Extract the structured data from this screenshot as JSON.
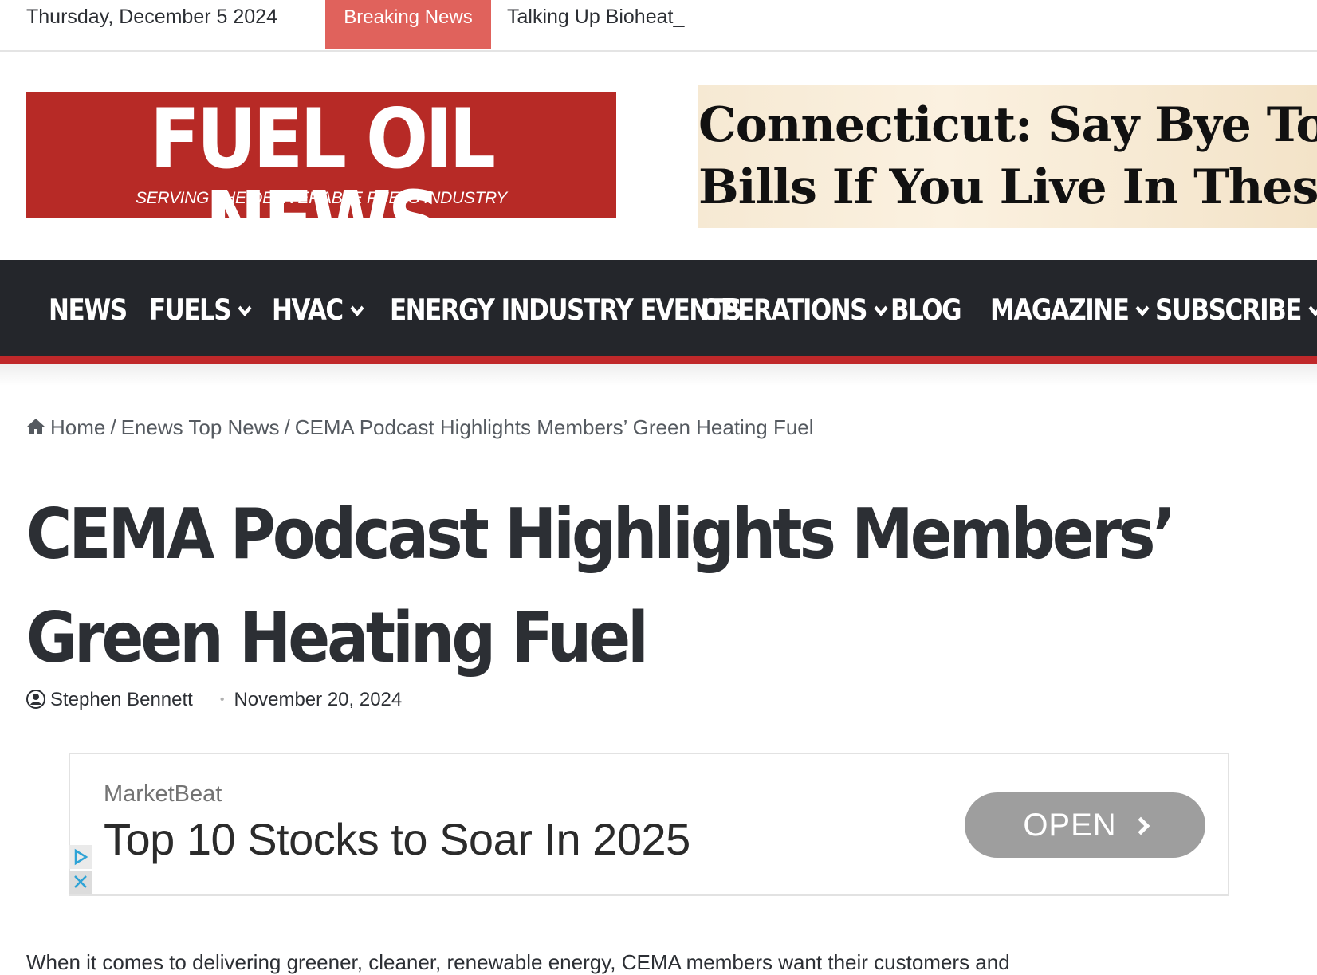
{
  "topbar": {
    "date": "Thursday, December 5 2024",
    "breaking_label": "Breaking News",
    "ticker_text": "Talking Up Bioheat_"
  },
  "header": {
    "logo_title": "FUEL OIL NEWS",
    "logo_subtitle": "SERVING THE DELIVERABLE FUELS INDUSTRY",
    "ad_line1": "Connecticut: Say Bye To",
    "ad_line2": "Bills If You Live In Thes"
  },
  "nav": {
    "items": [
      {
        "label": "NEWS",
        "dropdown": false
      },
      {
        "label": "FUELS",
        "dropdown": true
      },
      {
        "label": "HVAC",
        "dropdown": true
      },
      {
        "label": "ENERGY INDUSTRY EVENTS",
        "dropdown": false
      },
      {
        "label": "OPERATIONS",
        "dropdown": true
      },
      {
        "label": "BLOG",
        "dropdown": false
      },
      {
        "label": "MAGAZINE",
        "dropdown": true
      },
      {
        "label": "SUBSCRIBE",
        "dropdown": true
      }
    ]
  },
  "breadcrumb": {
    "home": "Home",
    "sep": "/",
    "section": "Enews Top News",
    "current": "CEMA Podcast Highlights Members’ Green Heating Fuel"
  },
  "article": {
    "title": "CEMA Podcast Highlights Members’ Green Heating Fuel",
    "author": "Stephen Bennett",
    "meta_dot": "•",
    "date": "November 20, 2024",
    "body_first_line": "When it comes to delivering greener, cleaner, renewable energy, CEMA members want their customers and"
  },
  "ad": {
    "source": "MarketBeat",
    "headline": "Top 10 Stocks to Soar In 2025",
    "button_label": "OPEN"
  },
  "colors": {
    "brand_red": "#b72a26",
    "breaking_red": "#e0625c",
    "nav_bg": "#24262b",
    "nav_border": "#c0282a"
  },
  "icons": [
    "home-icon",
    "user-icon",
    "chevron-down-icon",
    "chevron-right-icon",
    "adchoices-icon",
    "close-icon"
  ]
}
